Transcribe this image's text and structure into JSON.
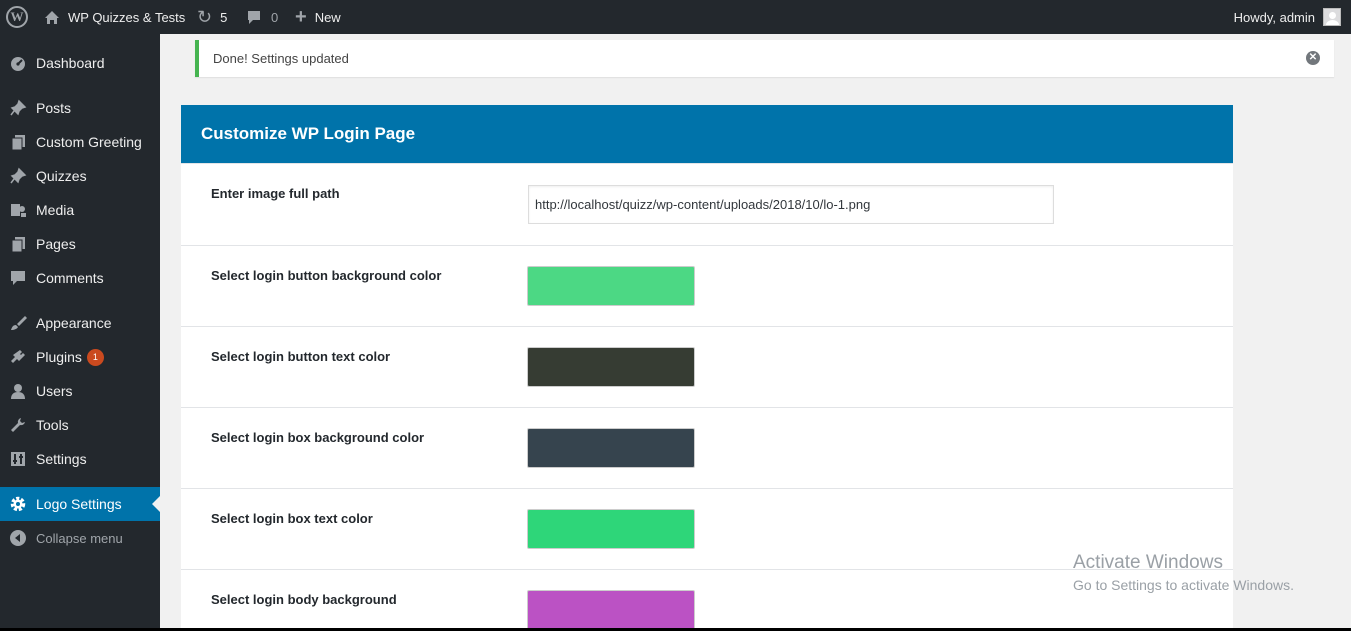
{
  "admin_bar": {
    "site_name": "WP Quizzes & Tests",
    "updates_count": "5",
    "comments_count": "0",
    "new_label": "New",
    "howdy": "Howdy, admin"
  },
  "sidebar": {
    "items": [
      {
        "label": "Dashboard",
        "icon": "dashboard-icon"
      },
      {
        "label": "Posts",
        "icon": "pin-icon"
      },
      {
        "label": "Custom Greeting",
        "icon": "pages-icon"
      },
      {
        "label": "Quizzes",
        "icon": "pin-icon"
      },
      {
        "label": "Media",
        "icon": "media-icon"
      },
      {
        "label": "Pages",
        "icon": "pages-icon"
      },
      {
        "label": "Comments",
        "icon": "comment-icon"
      },
      {
        "label": "Appearance",
        "icon": "brush-icon"
      },
      {
        "label": "Plugins",
        "icon": "plug-icon",
        "badge": "1"
      },
      {
        "label": "Users",
        "icon": "user-icon"
      },
      {
        "label": "Tools",
        "icon": "wrench-icon"
      },
      {
        "label": "Settings",
        "icon": "sliders-icon"
      },
      {
        "label": "Logo Settings",
        "icon": "gear-icon",
        "current": true
      },
      {
        "label": "Collapse menu",
        "icon": "collapse-icon"
      }
    ]
  },
  "notice": {
    "message": "Done! Settings updated",
    "dismiss_icon": "dismiss-icon"
  },
  "panel": {
    "title": "Customize WP Login Page",
    "fields": [
      {
        "label": "Enter image full path",
        "type": "text",
        "value": "http://localhost/quizz/wp-content/uploads/2018/10/lo-1.png"
      },
      {
        "label": "Select login button background color",
        "type": "color",
        "color": "#4cd884"
      },
      {
        "label": "Select login button text color",
        "type": "color",
        "color": "#363c33"
      },
      {
        "label": "Select login box background color",
        "type": "color",
        "color": "#36444e"
      },
      {
        "label": "Select login box text color",
        "type": "color",
        "color": "#2ed679"
      },
      {
        "label": "Select login body background",
        "type": "color",
        "color": "#bb52c4"
      }
    ]
  },
  "watermark": {
    "line1": "Activate Windows",
    "line2": "Go to Settings to activate Windows."
  },
  "colors": {
    "admin_bar": "#23282d",
    "accent": "#0073aa",
    "notice_success": "#46b450",
    "plugin_badge": "#ca4a1f"
  }
}
